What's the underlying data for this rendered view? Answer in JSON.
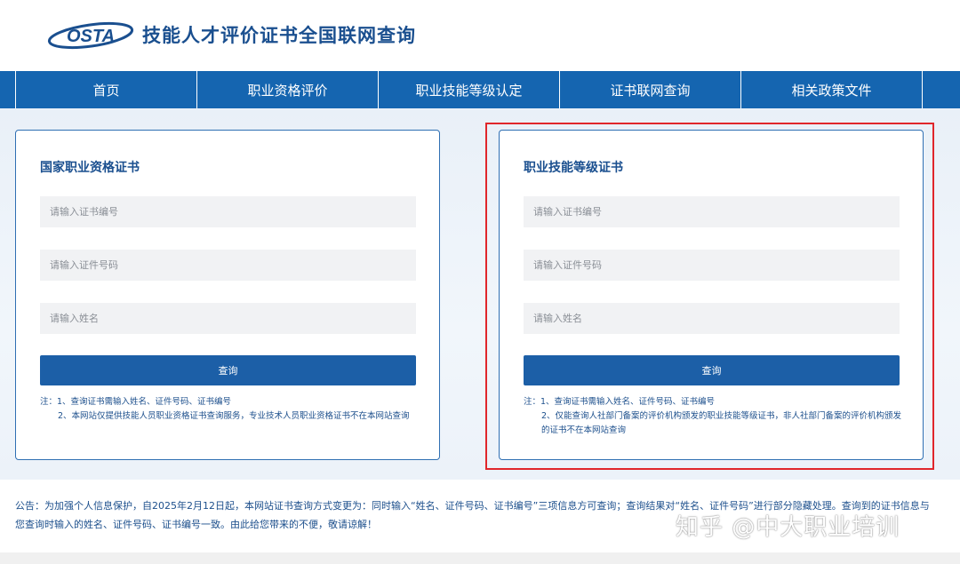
{
  "header": {
    "logo_text": "OSTA",
    "title": "技能人才评价证书全国联网查询"
  },
  "nav": {
    "items": [
      "首页",
      "职业资格评价",
      "职业技能等级认定",
      "证书联网查询",
      "相关政策文件"
    ]
  },
  "cards": [
    {
      "title": "国家职业资格证书",
      "fields": [
        {
          "placeholder": "请输入证书编号",
          "value": ""
        },
        {
          "placeholder": "请输入证件号码",
          "value": ""
        },
        {
          "placeholder": "请输入姓名",
          "value": ""
        }
      ],
      "button": "查询",
      "notes": [
        "注：1、查询证书需输入姓名、证件号码、证书编号",
        "2、本网站仅提供技能人员职业资格证书查询服务，专业技术人员职业资格证书不在本网站查询"
      ]
    },
    {
      "title": "职业技能等级证书",
      "fields": [
        {
          "placeholder": "请输入证书编号",
          "value": ""
        },
        {
          "placeholder": "请输入证件号码",
          "value": ""
        },
        {
          "placeholder": "请输入姓名",
          "value": ""
        }
      ],
      "button": "查询",
      "notes": [
        "注：1、查询证书需输入姓名、证件号码、证书编号",
        "2、仅能查询人社部门备案的评价机构颁发的职业技能等级证书，非人社部门备案的评价机构颁发的证书不在本网站查询"
      ]
    }
  ],
  "announcement": "公告：为加强个人信息保护，自2025年2月12日起，本网站证书查询方式变更为：同时输入“姓名、证件号码、证书编号”三项信息方可查询；查询结果对“姓名、证件号码”进行部分隐藏处理。查询到的证书信息与您查询时输入的姓名、证件号码、证书编号一致。由此给您带来的不便，敬请谅解！",
  "watermark": "知乎 @中大职业培训",
  "colors": {
    "nav_bg": "#1565b0",
    "title_blue": "#1a4f8f",
    "button_bg": "#1c5fa7",
    "highlight_red": "#e0262b"
  }
}
